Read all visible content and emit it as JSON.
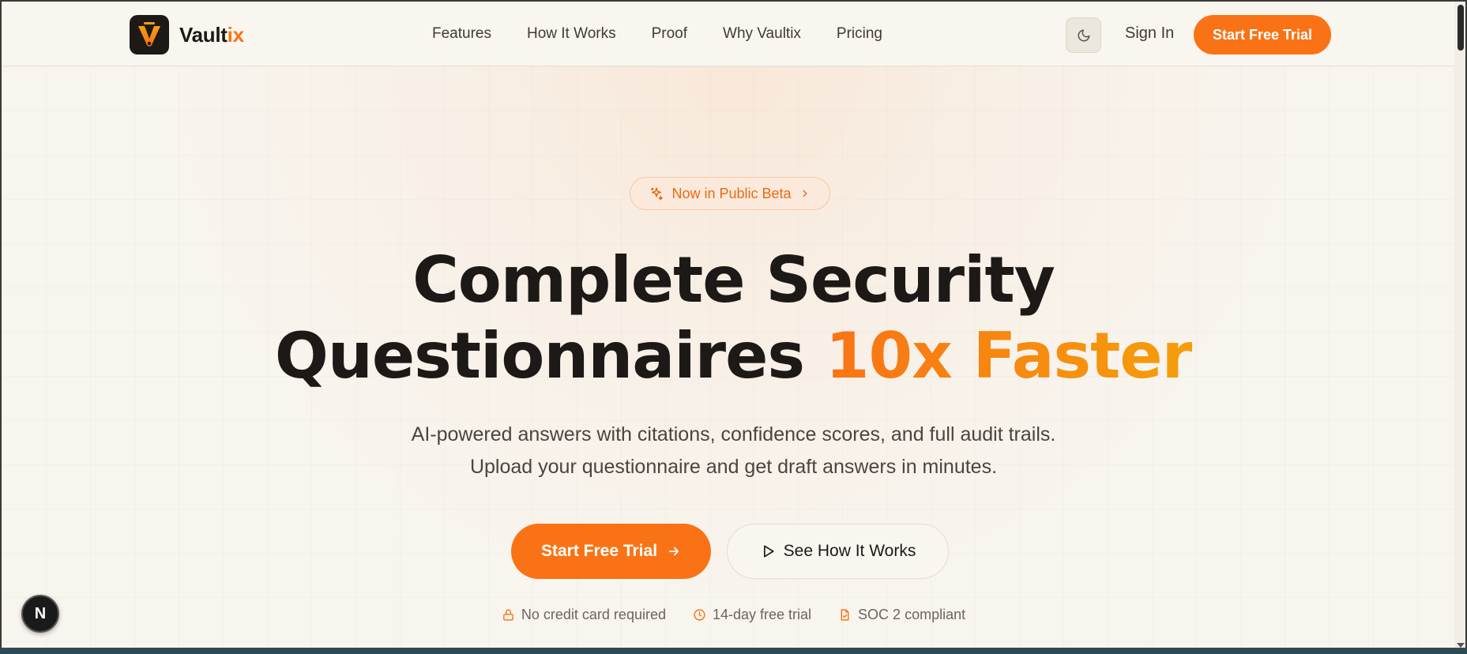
{
  "brand": {
    "name_main": "Vault",
    "name_accent": "ix",
    "accent_color": "#f97316"
  },
  "nav": {
    "links": [
      "Features",
      "How It Works",
      "Proof",
      "Why Vaultix",
      "Pricing"
    ],
    "theme_toggle_icon": "moon-icon",
    "sign_in": "Sign In",
    "cta": "Start Free Trial"
  },
  "hero": {
    "badge": "Now in Public Beta",
    "headline_line1": "Complete Security",
    "headline_line2_main": "Questionnaires ",
    "headline_line2_accent": "10x Faster",
    "subtitle": "AI-powered answers with citations, confidence scores, and full audit trails. Upload your questionnaire and get draft answers in minutes.",
    "primary_cta": "Start Free Trial",
    "secondary_cta": "See How It Works",
    "trust": [
      {
        "icon": "lock-icon",
        "label": "No credit card required"
      },
      {
        "icon": "clock-icon",
        "label": "14-day free trial"
      },
      {
        "icon": "document-check-icon",
        "label": "SOC 2 compliant"
      }
    ]
  },
  "dev_badge": "N"
}
